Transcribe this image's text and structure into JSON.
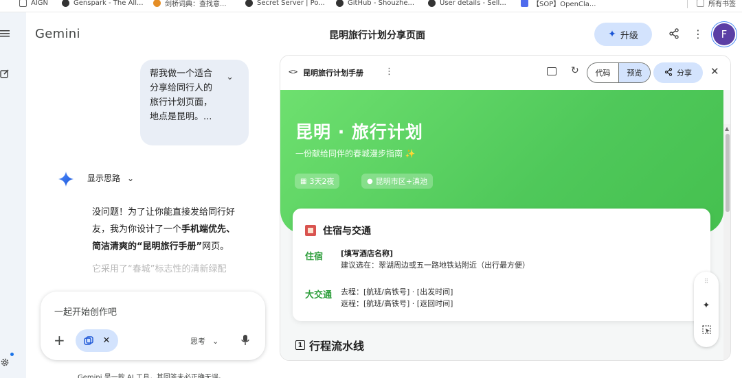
{
  "bookmarks": [
    {
      "label": "AIGN",
      "icon": "folder-icon"
    },
    {
      "label": "Genspark - The All...",
      "icon": "genspark-icon"
    },
    {
      "label": "剑桥词典：查找意...",
      "icon": "cambridge-icon"
    },
    {
      "label": "Secret Server | Po...",
      "icon": "secret-server-icon"
    },
    {
      "label": "GitHub - Shouzhe...",
      "icon": "github-icon"
    },
    {
      "label": "User details - Sell...",
      "icon": "user-details-icon"
    },
    {
      "label": "【SOP】OpenCla...",
      "icon": "doc-icon"
    },
    {
      "label": "所有书签",
      "icon": "folder-icon"
    }
  ],
  "app": {
    "title": "Gemini",
    "page_title": "昆明旅行计划分享页面",
    "upgrade_label": "升级",
    "avatar_letter": "F",
    "avatar_color": "#5b3fa5",
    "accent_color": "#d3e3fd"
  },
  "chat": {
    "user_message": "帮我做一个适合分享给同行人的旅行计划页面，地点是昆明。...",
    "thinking_label": "显示思路",
    "reply_p1_a": "没问题！为了让你能直接发给同行好友，我为你设计了一个",
    "reply_p1_bold": "手机端优先、简洁清爽的“昆明旅行手册”",
    "reply_p1_b": "网页。",
    "reply_p2": "它采用了“春城”标志性的清新绿配"
  },
  "input": {
    "placeholder": "一起开始创作吧",
    "mode_label": "思考"
  },
  "disclaimer": "Gemini 是一款 AI 工具，其回答未必正确无误。",
  "canvas": {
    "title": "昆明旅行计划手册",
    "code_label": "代码",
    "preview_label": "预览",
    "share_label": "分享",
    "hero_title": "昆明 · 旅行计划",
    "hero_subtitle": "一份献给同伴的春城漫步指南 ✨",
    "pill_duration": "3天2夜",
    "pill_location": "昆明市区+滇池",
    "card_title": "住宿与交通",
    "stay_label": "住宿",
    "stay_name": "[填写酒店名称]",
    "stay_advice": "建议选在：翠湖周边或五一路地铁站附近（出行最方便）",
    "transport_label": "大交通",
    "transport_go": "去程：[航班/高铁号] · [出发时间]",
    "transport_back": "返程：[航班/高铁号] · [返回时间]",
    "section_title": "行程流水线",
    "hero_color": "#52c95c",
    "label_color": "#2e9e3c"
  }
}
